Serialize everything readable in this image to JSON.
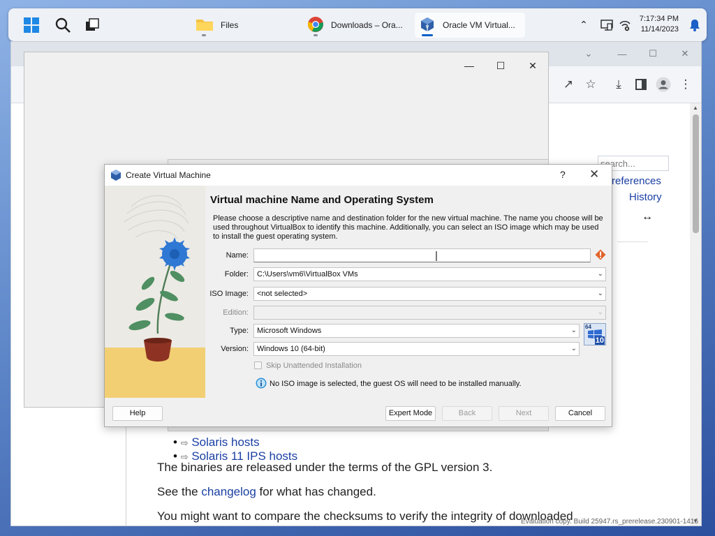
{
  "taskbar": {
    "apps": [
      {
        "label": "Files",
        "icon": "folder-icon"
      },
      {
        "label": "Downloads – Ora...",
        "icon": "chrome-icon"
      },
      {
        "label": "Oracle VM Virtual...",
        "icon": "virtualbox-icon"
      }
    ],
    "time": "7:17:34 PM",
    "date": "11/14/2023"
  },
  "browser": {
    "search_placeholder": "search...",
    "nav_links": [
      "references",
      "History"
    ],
    "list_items": [
      "Solaris hosts",
      "Solaris 11 IPS hosts"
    ],
    "para1": "The binaries are released under the terms of the GPL version 3.",
    "para2_pre": "See the ",
    "para2_link": "changelog",
    "para2_post": " for what has changed.",
    "para3": "You might want to compare the checksums to verify the integrity of downloaded",
    "watermark": "Evaluation copy. Build 25947.rs_prerelease.230901-1416"
  },
  "dialog": {
    "title": "Create Virtual Machine",
    "help_glyph": "?",
    "heading": "Virtual machine Name and Operating System",
    "description": "Please choose a descriptive name and destination folder for the new virtual machine. The name you choose will be used throughout VirtualBox to identify this machine. Additionally, you can select an ISO image which may be used to install the guest operating system.",
    "fields": {
      "name_label": "Name:",
      "name_value": "",
      "folder_label": "Folder:",
      "folder_value": "C:\\Users\\vm6\\VirtualBox VMs",
      "iso_label": "ISO Image:",
      "iso_value": "<not selected>",
      "edition_label": "Edition:",
      "edition_value": "",
      "type_label": "Type:",
      "type_value": "Microsoft Windows",
      "version_label": "Version:",
      "version_value": "Windows 10 (64-bit)"
    },
    "os_badge": {
      "top": "64",
      "bottom": "10"
    },
    "skip_unattended_label": "Skip Unattended Installation",
    "skip_unattended_checked": false,
    "info_message": "No ISO image is selected, the guest OS will need to be installed manually.",
    "buttons": {
      "help": "Help",
      "expert": "Expert Mode",
      "back": "Back",
      "next": "Next",
      "cancel": "Cancel"
    }
  },
  "colors": {
    "accent": "#0a5fc8",
    "link": "#1a3fa3",
    "warning": "#e2632b",
    "info": "#2a8fd6"
  }
}
